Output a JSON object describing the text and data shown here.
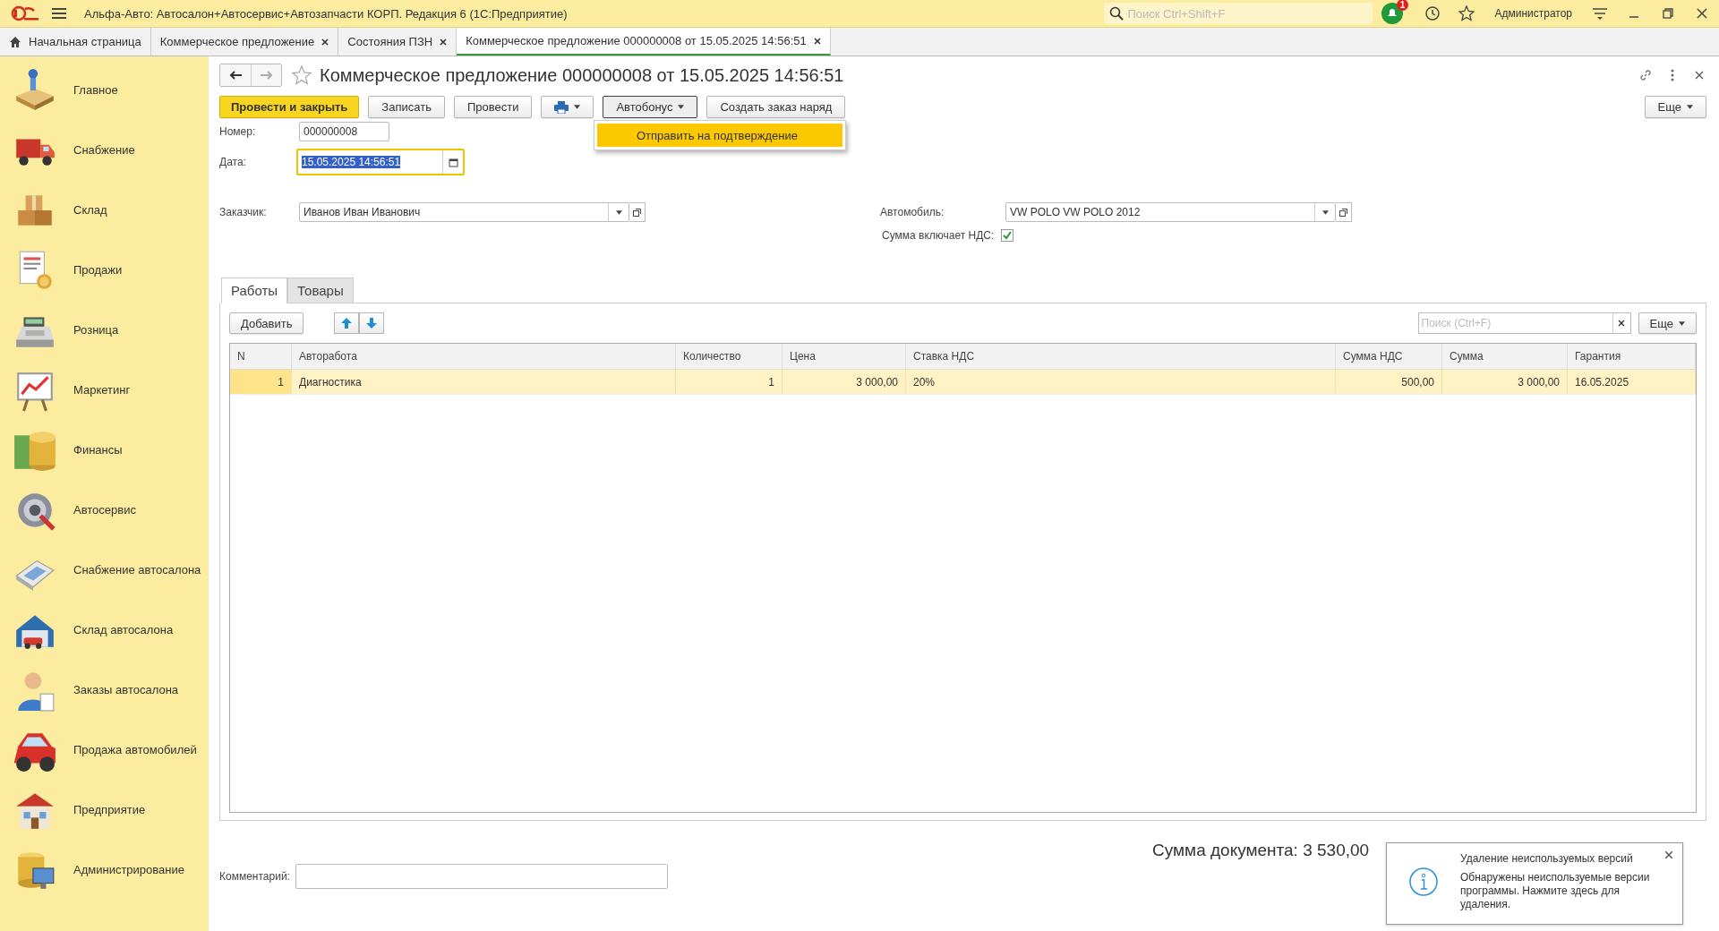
{
  "app": {
    "title": "Альфа-Авто: Автосалон+Автосервис+Автозапчасти КОРП. Редакция 6  (1С:Предприятие)",
    "search": {
      "placeholder": "Поиск Ctrl+Shift+F"
    },
    "notification_count": "1",
    "user": "Администратор"
  },
  "open_tabs": [
    {
      "label": "Начальная страница",
      "kind": "home",
      "selected": false
    },
    {
      "label": "Коммерческое предложение",
      "kind": "doc",
      "selected": false
    },
    {
      "label": "Состояния ПЗН",
      "kind": "doc",
      "selected": false
    },
    {
      "label": "Коммерческое предложение 000000008 от 15.05.2025 14:56:51",
      "kind": "doc",
      "selected": true
    }
  ],
  "sidebar": {
    "items": [
      {
        "label": "Главное"
      },
      {
        "label": "Снабжение"
      },
      {
        "label": "Склад"
      },
      {
        "label": "Продажи"
      },
      {
        "label": "Розница"
      },
      {
        "label": "Маркетинг"
      },
      {
        "label": "Финансы"
      },
      {
        "label": "Автосервис"
      },
      {
        "label": "Снабжение автосалона"
      },
      {
        "label": "Склад автосалона"
      },
      {
        "label": "Заказы автосалона"
      },
      {
        "label": "Продажа автомобилей"
      },
      {
        "label": "Предприятие"
      },
      {
        "label": "Администрирование"
      }
    ]
  },
  "document": {
    "title": "Коммерческое предложение 000000008 от 15.05.2025 14:56:51",
    "buttons": [
      {
        "label": "Провести и закрыть",
        "kind": "primary"
      },
      {
        "label": "Записать",
        "kind": "normal"
      },
      {
        "label": "Провести",
        "kind": "normal"
      },
      {
        "kind": "print"
      },
      {
        "label": "Автобонус",
        "kind": "dropdown"
      },
      {
        "label": "Создать заказ наряд",
        "kind": "normal"
      }
    ],
    "menu": {
      "items": [
        {
          "label": "Отправить на подтверждение",
          "selected": true
        }
      ]
    },
    "more": "Еще",
    "number": {
      "label": "Номер:",
      "value": "000000008"
    },
    "date": {
      "label": "Дата:",
      "value": "15.05.2025 14:56:51",
      "focused": true
    },
    "customer": {
      "label": "Заказчик:",
      "value": "Иванов Иван Иванович"
    },
    "car": {
      "label": "Автомобиль:",
      "value": "VW POLO VW POLO 2012"
    },
    "vat_included": {
      "label": "Сумма включает НДС:",
      "checked": true
    },
    "tabs": [
      {
        "label": "Работы",
        "selected": true
      },
      {
        "label": "Товары",
        "selected": false
      }
    ],
    "table_toolbar": {
      "add": "Добавить",
      "search": {
        "placeholder": "Поиск (Ctrl+F)"
      },
      "more": "Еще"
    },
    "table": {
      "columns": [
        "N",
        "Авторабота",
        "Количество",
        "Цена",
        "Ставка НДС",
        "Сумма НДС",
        "Сумма",
        "Гарантия"
      ],
      "rows": [
        {
          "cells": [
            "1",
            "Диагностика",
            "1",
            "3 000,00",
            "20%",
            "500,00",
            "3 000,00",
            "16.05.2025"
          ],
          "selected": true
        }
      ]
    },
    "total": "Сумма документа: 3 530,00",
    "comment": {
      "label": "Комментарий:"
    }
  },
  "notification": {
    "title": "Удаление неиспользуемых версий",
    "text": "Обнаружены неиспользуемые версии программы. Нажмите здесь для удаления."
  }
}
